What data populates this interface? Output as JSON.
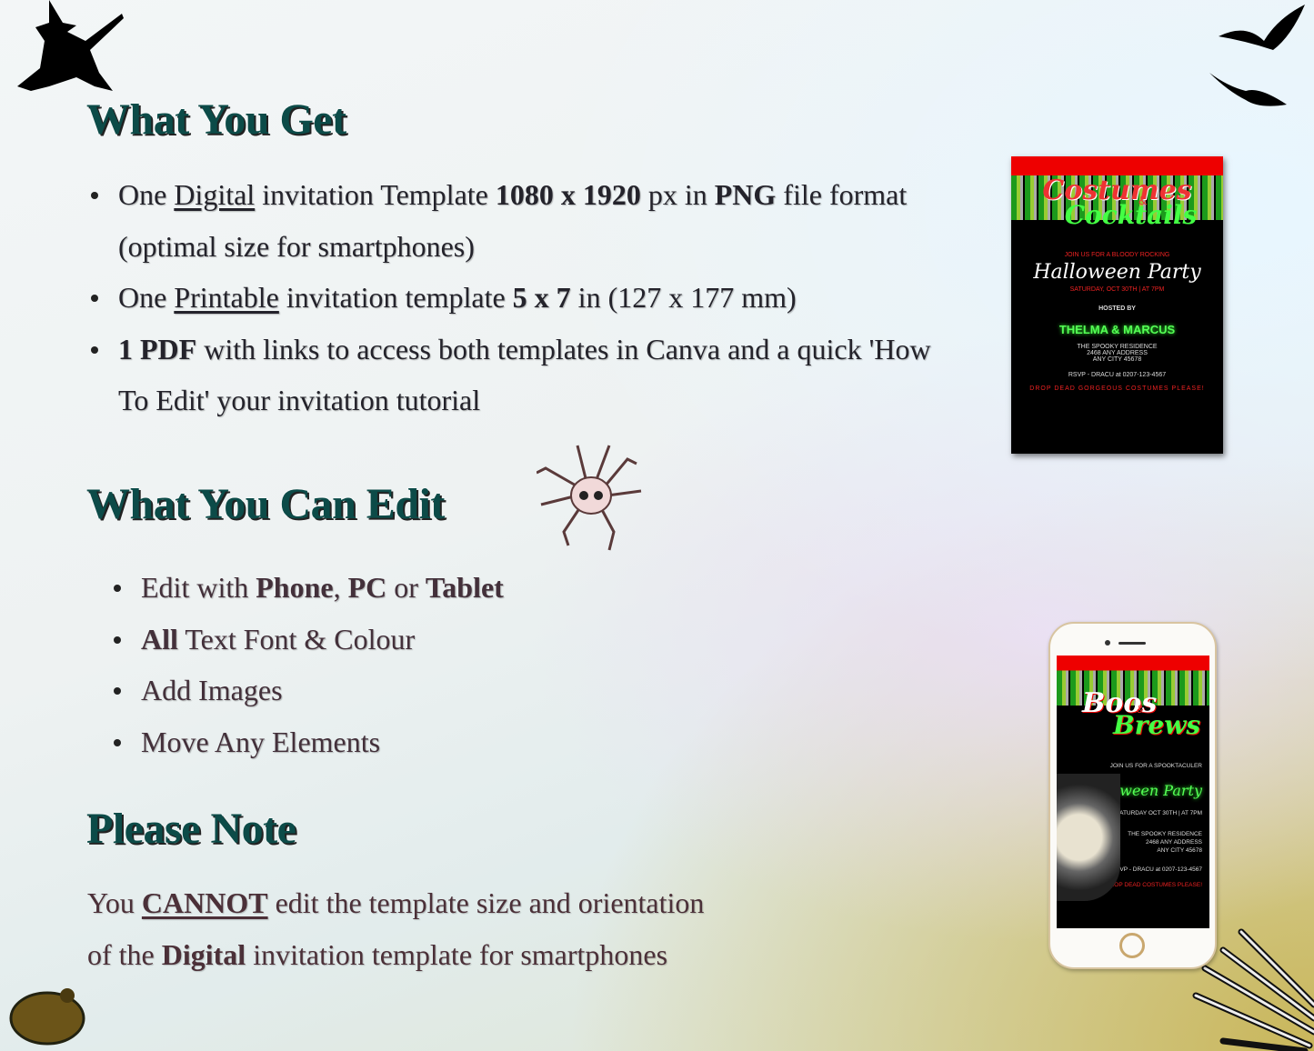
{
  "sections": {
    "get": {
      "title": "What You Get",
      "items": [
        {
          "a": "One ",
          "u": "Digital",
          "b": " invitation Template ",
          "s1": "1080 x 1920",
          "c": " px in ",
          "s2": "PNG",
          "d": " file format (optimal size for smartphones)"
        },
        {
          "a": "One ",
          "u": "Printable",
          "b": " invitation template ",
          "s1": "5 x 7",
          "c": " in (127 x 177 mm)"
        },
        {
          "s1": "1 PDF",
          "a": " with links to  access both templates in Canva and a quick  'How To Edit' your invitation tutorial"
        }
      ]
    },
    "edit": {
      "title": "What You Can Edit",
      "items": [
        {
          "a": "Edit with ",
          "s1": "Phone",
          "b": ", ",
          "s2": "PC",
          "c": " or ",
          "s3": "Tablet"
        },
        {
          "s1": "All",
          "a": " Text Font & Colour"
        },
        {
          "a": "Add Images"
        },
        {
          "a": "Move Any Elements"
        }
      ]
    },
    "note": {
      "title": "Please Note",
      "a": "You ",
      "u": "CANNOT",
      "b": " edit the template size and orientation",
      "c": "of the ",
      "s1": "Digital",
      "d": " invitation template for smartphones"
    }
  },
  "printable_preview": {
    "title1": "Costumes",
    "amp": "&",
    "title2": "Cocktails",
    "intro": "JOIN US FOR A BLOODY ROCKING",
    "party": "Halloween Party",
    "date": "SATURDAY, OCT 30TH | AT 7PM",
    "hosted": "HOSTED BY",
    "hosts": "THELMA & MARCUS",
    "addr1": "THE SPOOKY RESIDENCE",
    "addr2": "2468 ANY ADDRESS",
    "addr3": "ANY CITY 45678",
    "rsvp": "RSVP - DRACU at 0207-123-4567",
    "foot": "DROP DEAD GORGEOUS COSTUMES PLEASE!"
  },
  "digital_preview": {
    "title1": "Boos",
    "amp": "&",
    "title2": "Brews",
    "intro": "JOIN US FOR A SPOOKTACULER",
    "party": "Halloween Party",
    "date": "SATURDAY OCT 30TH | AT 7PM",
    "addr1": "THE SPOOKY RESIDENCE",
    "addr2": "2468 ANY ADDRESS",
    "addr3": "ANY CITY 45678",
    "rsvp": "RSVP - DRACU at 0207-123-4567",
    "foot": "DROP DEAD COSTUMES PLEASE!"
  },
  "icons": [
    "witch-icon",
    "bats-icon",
    "spider-skull-icon",
    "frog-icon",
    "skeleton-hand-icon"
  ]
}
